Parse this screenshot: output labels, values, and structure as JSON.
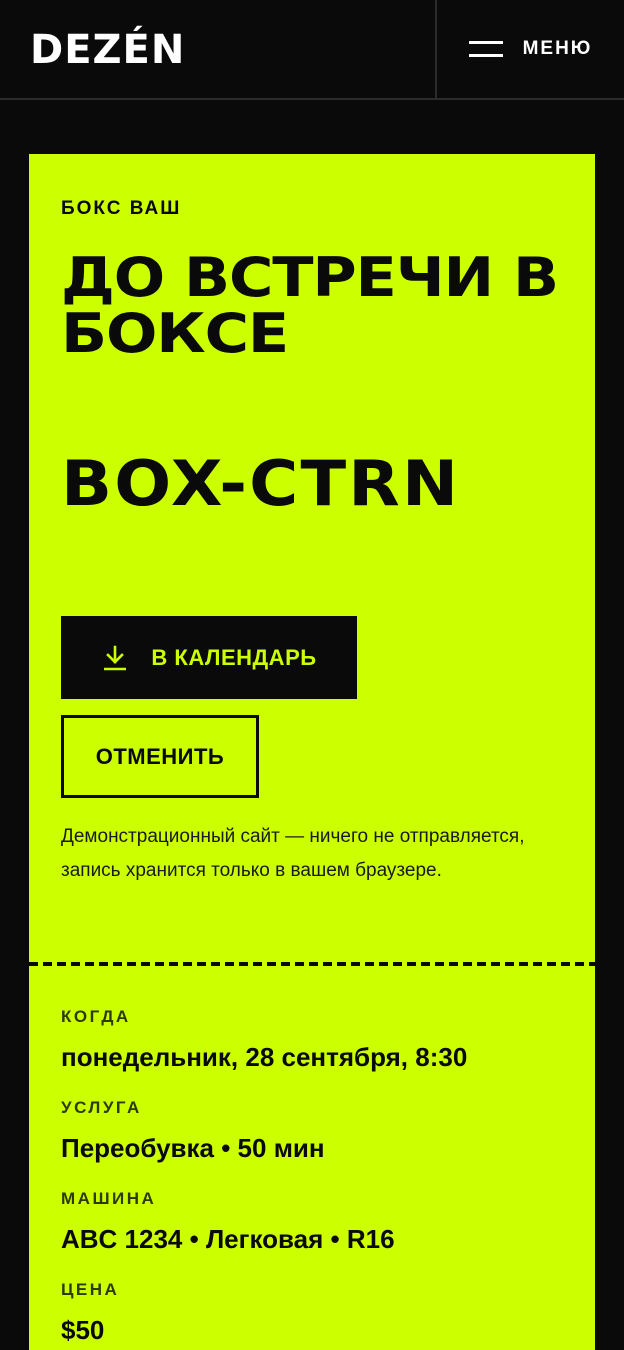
{
  "header": {
    "logo": "DEZÉN",
    "menu_label": "МЕНЮ",
    "menu_icon": "hamburger-icon"
  },
  "ticket": {
    "eyebrow": "БОКС ВАШ",
    "headline": "ДО ВСТРЕЧИ В БОКСЕ",
    "code": "BOX-CTRN",
    "calendar_button": {
      "label": "В КАЛЕНДАРЬ",
      "icon": "download-icon"
    },
    "cancel_button": {
      "label": "ОТМЕНИТЬ"
    },
    "disclaimer": "Демонстрационный сайт — ничего не отправляется, запись хранится только в вашем браузере."
  },
  "details": [
    {
      "label": "КОГДА",
      "value": "понедельник, 28 сентября, 8:30"
    },
    {
      "label": "УСЛУГА",
      "value": "Переобувка • 50 мин"
    },
    {
      "label": "МАШИНА",
      "value": "ABC 1234 • Легковая • R16"
    },
    {
      "label": "ЦЕНА",
      "value": "$50"
    }
  ],
  "colors": {
    "background": "#0a0a0a",
    "accent": "#ccff00",
    "text_dark": "#0a0a0a",
    "text_light": "#ffffff"
  }
}
